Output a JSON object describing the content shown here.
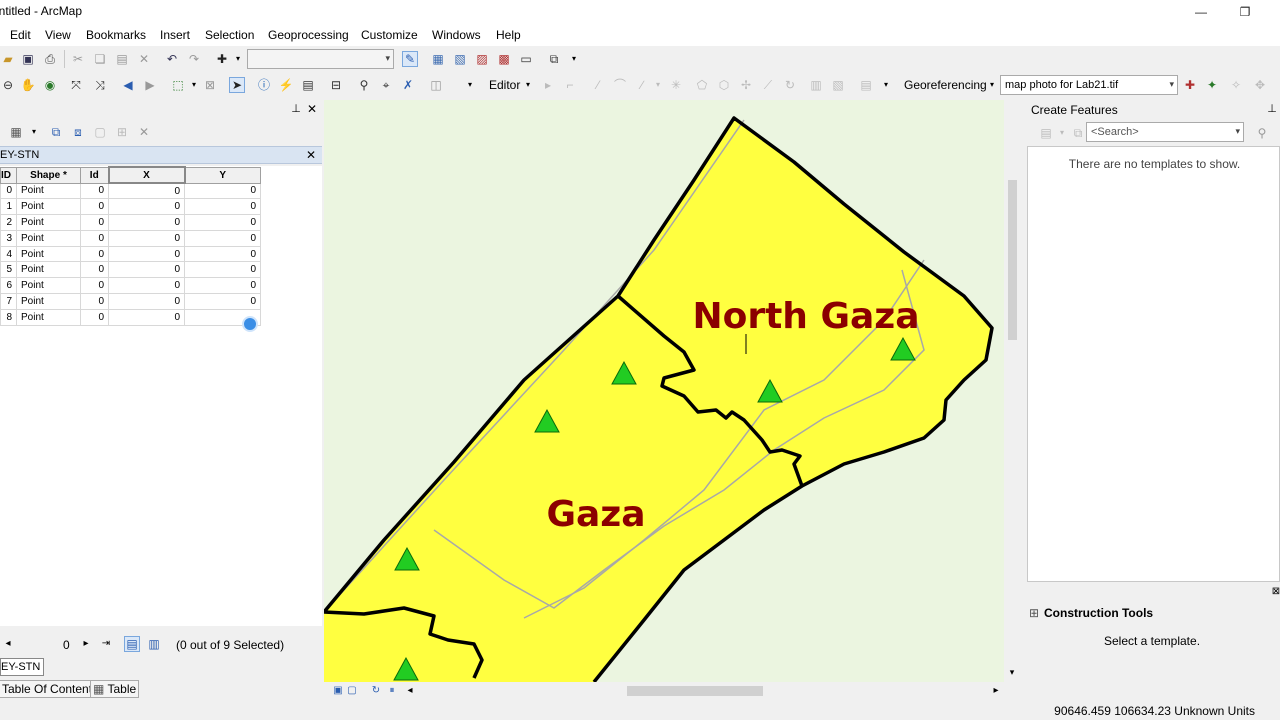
{
  "window": {
    "title": "Untitled - ArcMap",
    "minimize_glyph": "—",
    "restore_glyph": "❐"
  },
  "menu": [
    "Edit",
    "View",
    "Bookmarks",
    "Insert",
    "Selection",
    "Geoprocessing",
    "Customize",
    "Windows",
    "Help"
  ],
  "toolbar": {
    "editor_label": "Editor",
    "georeferencing_label": "Georeferencing",
    "layer_select_value": "map photo for Lab21.tif"
  },
  "table_window": {
    "layer_name": "EY-STN",
    "columns": [
      "ID",
      "Shape *",
      "Id",
      "X",
      "Y"
    ],
    "rows": [
      {
        "fid": "0",
        "shape": "Point",
        "id": "0",
        "x": "0",
        "y": "0"
      },
      {
        "fid": "1",
        "shape": "Point",
        "id": "0",
        "x": "0",
        "y": "0"
      },
      {
        "fid": "2",
        "shape": "Point",
        "id": "0",
        "x": "0",
        "y": "0"
      },
      {
        "fid": "3",
        "shape": "Point",
        "id": "0",
        "x": "0",
        "y": "0"
      },
      {
        "fid": "4",
        "shape": "Point",
        "id": "0",
        "x": "0",
        "y": "0"
      },
      {
        "fid": "5",
        "shape": "Point",
        "id": "0",
        "x": "0",
        "y": "0"
      },
      {
        "fid": "6",
        "shape": "Point",
        "id": "0",
        "x": "0",
        "y": "0"
      },
      {
        "fid": "7",
        "shape": "Point",
        "id": "0",
        "x": "0",
        "y": "0"
      },
      {
        "fid": "8",
        "shape": "Point",
        "id": "0",
        "x": "0",
        "y": ""
      }
    ],
    "record_index": "0",
    "selection_status": "(0 out of 9 Selected)",
    "layer_tab": "EY-STN",
    "bottom_tabs": [
      "Table Of Contents",
      "Table"
    ]
  },
  "map": {
    "labels": {
      "north_gaza": "North Gaza",
      "gaza": "Gaza"
    },
    "colors": {
      "background": "#ebf5e0",
      "region_fill": "#ffff40",
      "border": "#000000",
      "road": "#a8a8a8",
      "label": "#8b0000",
      "marker": "#22cc22"
    }
  },
  "create_features": {
    "title": "Create Features",
    "search_placeholder": "<Search>",
    "empty_message": "There are no templates to show."
  },
  "construction_tools": {
    "title": "Construction Tools",
    "message": "Select a template."
  },
  "status_bar": {
    "coordinates": "90646.459  106634.23 Unknown Units"
  }
}
